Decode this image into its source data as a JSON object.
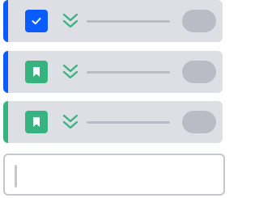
{
  "colors": {
    "card_background": "#dedfe4",
    "priority_chevron": "#36b37e",
    "placeholder_bar": "#b9bcc4",
    "input_border": "#c4c7cd"
  },
  "issues": [
    {
      "accent_color": "#0a5cff",
      "type_icon": "checkbox-icon",
      "type_icon_color": "#0a5cff",
      "priority_icon": "double-chevron-down-icon"
    },
    {
      "accent_color": "#0a5cff",
      "type_icon": "bookmark-icon",
      "type_icon_color": "#36b37e",
      "priority_icon": "double-chevron-down-icon"
    },
    {
      "accent_color": "#36b37e",
      "type_icon": "bookmark-icon",
      "type_icon_color": "#36b37e",
      "priority_icon": "double-chevron-down-icon"
    }
  ],
  "new_item": {
    "value": ""
  }
}
